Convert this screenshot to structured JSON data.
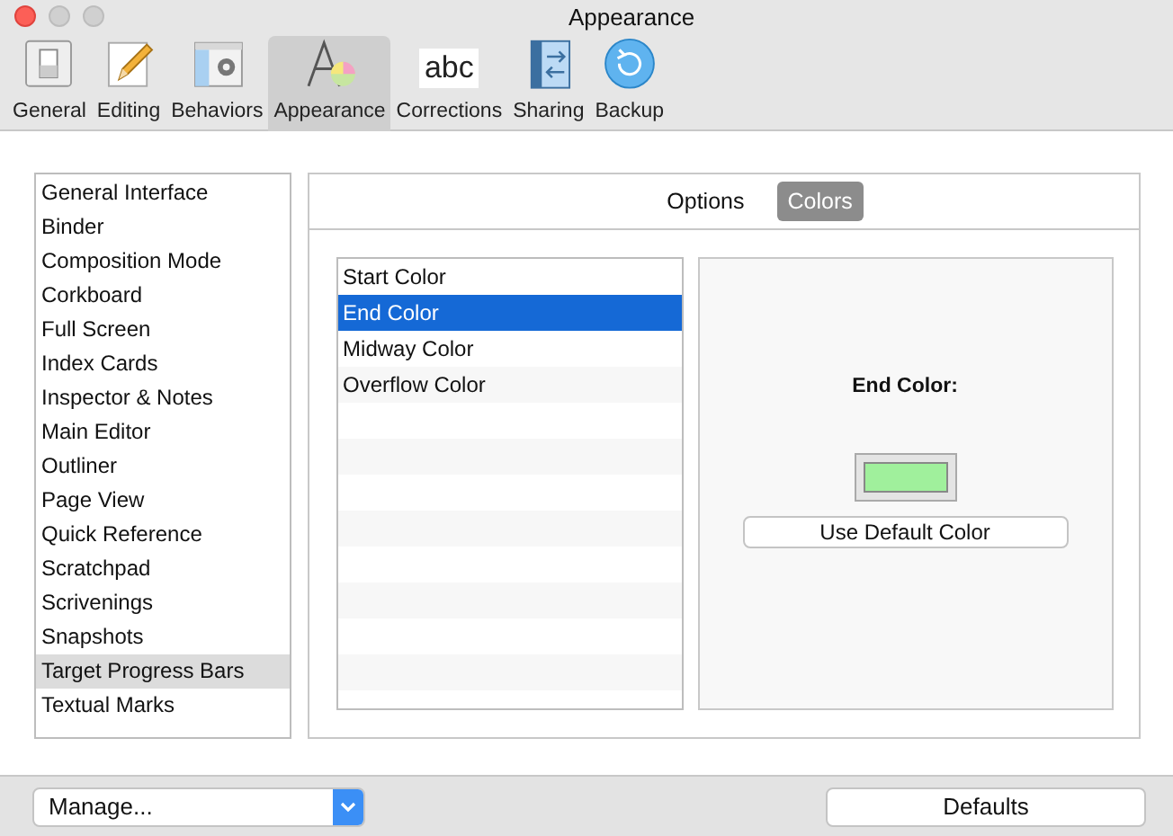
{
  "window": {
    "title": "Appearance"
  },
  "toolbar": {
    "items": [
      {
        "label": "General",
        "selected": false
      },
      {
        "label": "Editing",
        "selected": false
      },
      {
        "label": "Behaviors",
        "selected": false
      },
      {
        "label": "Appearance",
        "selected": true
      },
      {
        "label": "Corrections",
        "selected": false,
        "icon_text": "abc"
      },
      {
        "label": "Sharing",
        "selected": false
      },
      {
        "label": "Backup",
        "selected": false
      }
    ]
  },
  "sidebar": {
    "items": [
      {
        "label": "General Interface",
        "selected": false
      },
      {
        "label": "Binder",
        "selected": false
      },
      {
        "label": "Composition Mode",
        "selected": false
      },
      {
        "label": "Corkboard",
        "selected": false
      },
      {
        "label": "Full Screen",
        "selected": false
      },
      {
        "label": "Index Cards",
        "selected": false
      },
      {
        "label": "Inspector & Notes",
        "selected": false
      },
      {
        "label": "Main Editor",
        "selected": false
      },
      {
        "label": "Outliner",
        "selected": false
      },
      {
        "label": "Page View",
        "selected": false
      },
      {
        "label": "Quick Reference",
        "selected": false
      },
      {
        "label": "Scratchpad",
        "selected": false
      },
      {
        "label": "Scrivenings",
        "selected": false
      },
      {
        "label": "Snapshots",
        "selected": false
      },
      {
        "label": "Target Progress Bars",
        "selected": true
      },
      {
        "label": "Textual Marks",
        "selected": false
      }
    ]
  },
  "segments": [
    {
      "label": "Options",
      "selected": false
    },
    {
      "label": "Colors",
      "selected": true
    }
  ],
  "color_list": {
    "items": [
      {
        "label": "Start Color",
        "selected": false
      },
      {
        "label": "End Color",
        "selected": true
      },
      {
        "label": "Midway Color",
        "selected": false
      },
      {
        "label": "Overflow Color",
        "selected": false
      }
    ]
  },
  "detail": {
    "title": "End Color:",
    "swatch": {
      "color": "#a0f09c"
    },
    "button": "Use Default Color"
  },
  "footer": {
    "manage": "Manage...",
    "defaults": "Defaults"
  }
}
